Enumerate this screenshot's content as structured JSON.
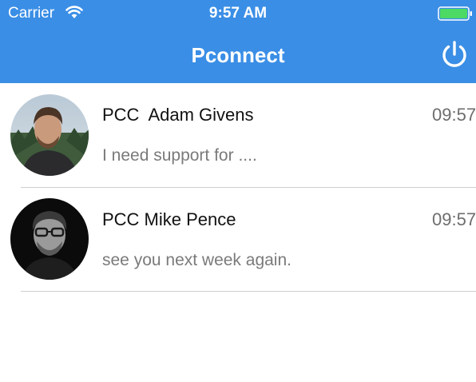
{
  "status_bar": {
    "carrier": "Carrier",
    "time": "9:57 AM",
    "wifi_icon": "wifi-icon",
    "battery_icon": "battery-icon",
    "battery_color": "#4cd964"
  },
  "nav": {
    "title": "Pconnect",
    "power_icon": "power-icon"
  },
  "colors": {
    "header_bg": "#3a8ee6",
    "divider": "#cfcfcf"
  },
  "chats": [
    {
      "name": "PCC  Adam Givens",
      "time": "09:57",
      "preview": "I need support for ....",
      "avatar_icon": "avatar-photo"
    },
    {
      "name": "PCC Mike Pence",
      "time": "09:57",
      "preview": "see you next week again.",
      "avatar_icon": "avatar-photo"
    }
  ]
}
